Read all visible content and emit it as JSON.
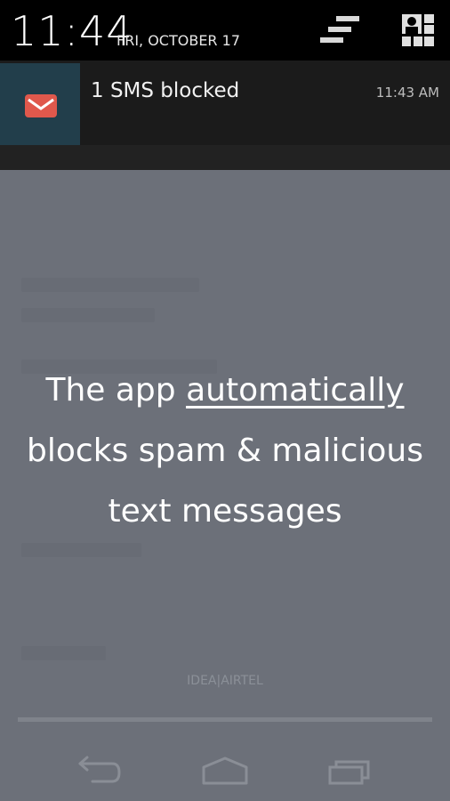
{
  "status": {
    "time": "11:44",
    "date": "FRI, OCTOBER 17"
  },
  "header_icons": {
    "clear": "clear-all-icon",
    "quick_settings": "quick-settings-icon"
  },
  "notification": {
    "icon": "mail-icon",
    "title": "1 SMS blocked",
    "time": "11:43 AM"
  },
  "overlay": {
    "prefix": "The app ",
    "emphasis": "automatically",
    "line2": "blocks spam & malicious",
    "line3": "text messages"
  },
  "carrier": "IDEA|AIRTEL",
  "nav": {
    "back": "back-icon",
    "home": "home-icon",
    "recents": "recents-icon"
  },
  "colors": {
    "shade": "#000000",
    "notification_bg": "#1b1b1b",
    "icon_bg": "#223e4b",
    "mail_red": "#e0584c",
    "overlay_bg": "#6c7079"
  }
}
